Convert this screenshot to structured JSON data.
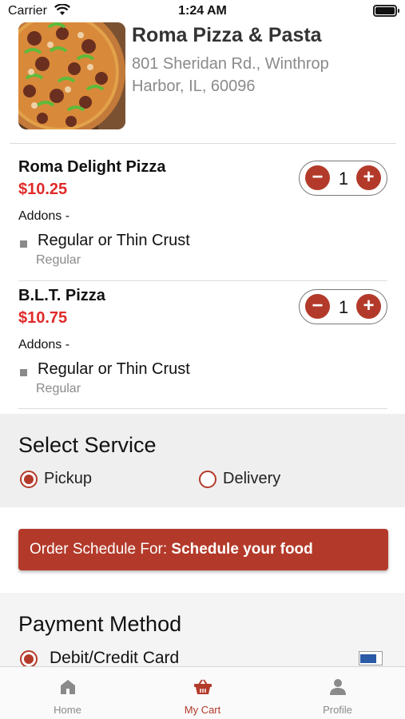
{
  "status_bar": {
    "carrier": "Carrier",
    "time": "1:24 AM"
  },
  "restaurant": {
    "name": "Roma Pizza & Pasta",
    "address_line1": "801 Sheridan Rd., Winthrop",
    "address_line2": "Harbor, IL, 60096"
  },
  "cart_items": [
    {
      "name": "Roma Delight Pizza",
      "price": "$10.25",
      "addons_label": "Addons -",
      "addon_name": "Regular or Thin Crust",
      "addon_value": "Regular",
      "quantity": "1",
      "minus": "−",
      "plus": "+"
    },
    {
      "name": "B.L.T. Pizza",
      "price": "$10.75",
      "addons_label": "Addons -",
      "addon_name": "Regular or Thin Crust",
      "addon_value": "Regular",
      "quantity": "1",
      "minus": "−",
      "plus": "+"
    }
  ],
  "service": {
    "title": "Select Service",
    "options": [
      {
        "label": "Pickup",
        "selected": true
      },
      {
        "label": "Delivery",
        "selected": false
      }
    ]
  },
  "schedule": {
    "prefix": "Order Schedule For:",
    "value": "Schedule your food"
  },
  "payment": {
    "title": "Payment Method",
    "option": {
      "label": "Debit/Credit Card",
      "selected": true
    }
  },
  "tabs": [
    {
      "label": "Home",
      "icon": "home-icon",
      "active": false
    },
    {
      "label": "My Cart",
      "icon": "basket-icon",
      "active": true
    },
    {
      "label": "Profile",
      "icon": "person-icon",
      "active": false
    }
  ],
  "colors": {
    "accent": "#b33a2a",
    "price": "#e02a2a",
    "muted": "#8a8a8a",
    "section_bg": "#efefef"
  }
}
